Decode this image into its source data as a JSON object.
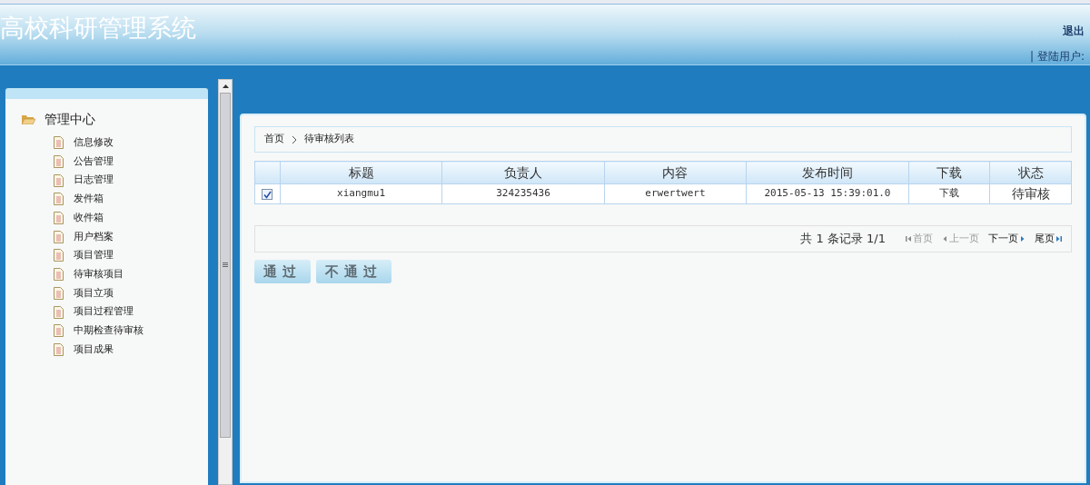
{
  "header": {
    "title": "高校科研管理系统",
    "logout": "退出",
    "user_label": "| 登陆用户:"
  },
  "sidebar": {
    "root": {
      "label": "管理中心",
      "expanded": true,
      "children": [
        {
          "label": "信息修改"
        },
        {
          "label": "公告管理"
        },
        {
          "label": "日志管理"
        },
        {
          "label": "发件箱"
        },
        {
          "label": "收件箱"
        },
        {
          "label": "用户档案"
        },
        {
          "label": "项目管理"
        },
        {
          "label": "待审核项目"
        },
        {
          "label": "项目立项"
        },
        {
          "label": "项目过程管理"
        },
        {
          "label": "中期检查待审核"
        },
        {
          "label": "项目成果"
        }
      ]
    }
  },
  "breadcrumb": [
    "首页",
    "待审核列表"
  ],
  "table": {
    "columns": [
      "标题",
      "负责人",
      "内容",
      "发布时间",
      "下载",
      "状态"
    ],
    "rows": [
      {
        "checked": true,
        "cells": [
          "xiangmu1",
          "324235436",
          "erwertwert",
          "2015-05-13 15:39:01.0",
          "下载",
          "待审核"
        ]
      }
    ]
  },
  "pager": {
    "summary": "共 1 条记录 1/1",
    "links": [
      {
        "label": "首页",
        "kind": "first",
        "disabled": true
      },
      {
        "label": "上一页",
        "kind": "prev",
        "disabled": true
      },
      {
        "label": "下一页",
        "kind": "next",
        "disabled": false
      },
      {
        "label": "尾页",
        "kind": "last",
        "disabled": false
      }
    ]
  },
  "buttons": [
    "通过",
    "不通过"
  ]
}
